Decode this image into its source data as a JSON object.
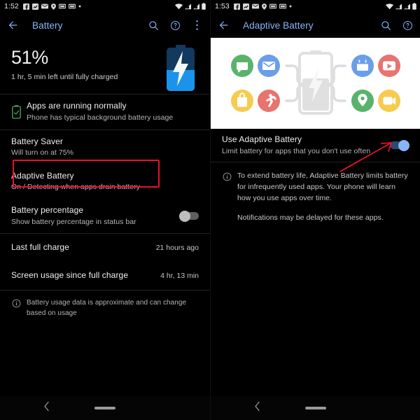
{
  "left": {
    "statusbar": {
      "clock": "1:52",
      "icons": [
        "facebook-icon",
        "chart-icon",
        "mail-icon",
        "location-pin-icon",
        "photo-icon",
        "photo-icon-2",
        "dot-icon"
      ],
      "right_icons": [
        "wifi-icon",
        "signal-icon",
        "signal-icon-2",
        "battery-icon"
      ]
    },
    "appbar": {
      "back": "back-arrow-icon",
      "title": "Battery",
      "actions": [
        "search-icon",
        "help-icon",
        "overflow-menu-icon"
      ]
    },
    "header": {
      "percent": "51%",
      "subtitle": "1 hr, 5 min left until fully charged",
      "battery_level_pct": 51,
      "battery_color_fill": "#1b93ec",
      "battery_color_empty": "#12395e"
    },
    "status_row": {
      "title": "Apps are running normally",
      "subtitle": "Phone has typical background battery usage",
      "icon": "battery-check-icon",
      "icon_color": "#3f8f4f"
    },
    "items": [
      {
        "name": "battery-saver",
        "title": "Battery Saver",
        "subtitle": "Will turn on at 75%",
        "control": "none"
      },
      {
        "name": "adaptive-battery",
        "title": "Adaptive Battery",
        "subtitle": "On / Detecting when apps drain battery",
        "control": "none",
        "highlighted": true
      },
      {
        "name": "battery-percentage",
        "title": "Battery percentage",
        "subtitle": "Show battery percentage in status bar",
        "control": "switch",
        "switch_state": "off"
      }
    ],
    "value_items": [
      {
        "name": "last-full-charge",
        "title": "Last full charge",
        "value": "21 hours ago"
      },
      {
        "name": "screen-usage",
        "title": "Screen usage since full charge",
        "value": "4 hr, 13 min"
      }
    ],
    "footnote": {
      "icon": "info-icon",
      "text": "Battery usage data is approximate and can change based on usage"
    },
    "highlight_color": "#e8112d"
  },
  "right": {
    "statusbar": {
      "clock": "1:53",
      "icons": [
        "facebook-icon",
        "chart-icon",
        "mail-icon",
        "location-pin-icon",
        "photo-icon",
        "photo-icon-2",
        "dot-icon"
      ],
      "right_icons": [
        "wifi-icon",
        "signal-icon",
        "signal-icon-2",
        "battery-icon"
      ]
    },
    "appbar": {
      "back": "back-arrow-icon",
      "title": "Adaptive Battery",
      "actions": [
        "search-icon",
        "help-icon"
      ]
    },
    "hero": {
      "name": "adaptive-battery-illustration",
      "background": "#ffffff",
      "app_bubbles": [
        {
          "name": "chat-bubble-icon",
          "color": "#59b36b",
          "position": "top-left-outer"
        },
        {
          "name": "mail-icon",
          "color": "#6b9ee8",
          "position": "top-left-inner"
        },
        {
          "name": "shopping-bag-icon",
          "color": "#f6cb4e",
          "position": "bottom-left-outer"
        },
        {
          "name": "running-person-icon",
          "color": "#e8736f",
          "position": "bottom-left-inner"
        },
        {
          "name": "calendar-icon",
          "color": "#6b9ee8",
          "position": "top-right-inner"
        },
        {
          "name": "play-video-icon",
          "color": "#e8736f",
          "position": "top-right-outer"
        },
        {
          "name": "location-pin-icon",
          "color": "#59b36b",
          "position": "bottom-right-inner"
        },
        {
          "name": "video-camera-icon",
          "color": "#f6cb4e",
          "position": "bottom-right-outer"
        }
      ],
      "center": "charging-battery-icon"
    },
    "toggle_row": {
      "title": "Use Adaptive Battery",
      "subtitle": "Limit battery for apps that you don't use often",
      "switch_state": "on",
      "switch_color": "#8ab4f8"
    },
    "info": {
      "icon": "info-icon",
      "paragraphs": [
        "To extend battery life, Adaptive Battery limits battery for infrequently used apps. Your phone will learn how you use apps over time.",
        "Notifications may be delayed for these apps."
      ]
    },
    "annotation": {
      "name": "red-arrow-annotation",
      "color": "#e8112d",
      "points_to": "adaptive-battery-switch"
    }
  },
  "navbar": {
    "back": "nav-back-icon",
    "home": "nav-home-pill"
  }
}
